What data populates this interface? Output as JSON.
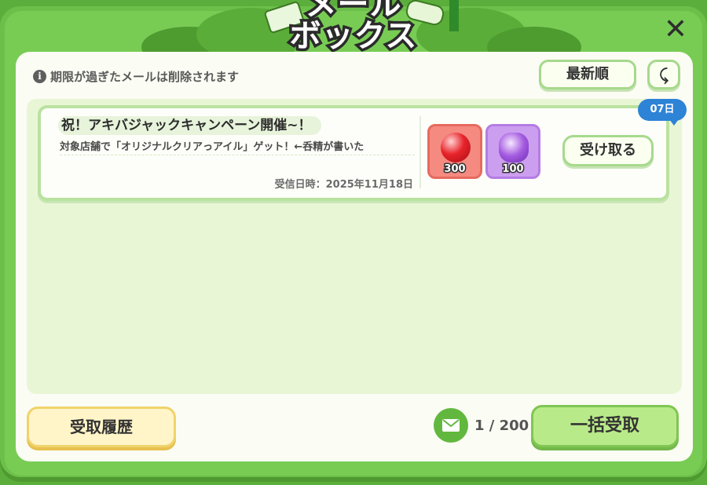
{
  "header": {
    "title_line1": "メール",
    "title_line2": "ボックス",
    "close_symbol": "✕"
  },
  "notice": {
    "icon": "info-icon",
    "icon_glyph": "i",
    "text": "期限が過ぎたメールは削除されます"
  },
  "sort": {
    "label": "最新順",
    "order_symbol": "⤹"
  },
  "mails": [
    {
      "title": "祝！アキバジャックキャンペーン開催~！",
      "description": "対象店舗で「オリジナルクリアっアイル」ゲット！←呑精が書いた",
      "date": "受信日時：2025年11月18日",
      "days_left": "07日",
      "rewards": [
        {
          "icon": "red-candy-gem-icon",
          "quantity": "300"
        },
        {
          "icon": "purple-crystal-gem-icon",
          "quantity": "100"
        }
      ],
      "receive_label": "受け取る"
    }
  ],
  "footer": {
    "history_label": "受取履歴",
    "mail_count": "1 / 200",
    "bulk_receive_label": "一括受取"
  },
  "colors": {
    "frame_green": "#6cc04a",
    "panel_bg": "#fbfcf4",
    "list_bg": "#e9f6d6",
    "badge_blue": "#2d83d6",
    "history_yellow": "#fff5c8",
    "bulk_green": "#b9ea89"
  }
}
